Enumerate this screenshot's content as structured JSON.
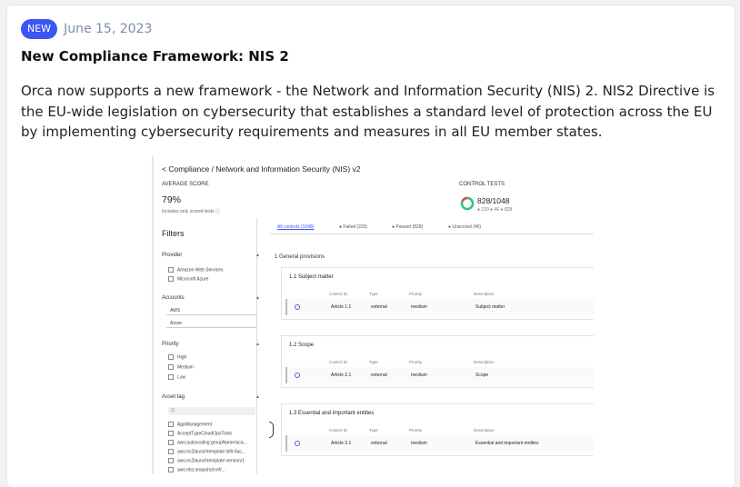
{
  "post": {
    "badge": "NEW",
    "date": "June 15, 2023",
    "title": "New Compliance Framework: NIS 2",
    "body": "Orca now supports a new framework - the Network and Information Security (NIS) 2.  NIS2 Directive is the EU-wide legislation on cybersecurity that establishes a standard level of protection across the EU by implementing cybersecurity requirements and measures in all EU member states."
  },
  "screenshot": {
    "breadcrumb": "< Compliance / Network and Information Security (NIS) v2",
    "avg_label": "AVERAGE SCORE",
    "avg_value": "79%",
    "avg_note": "Includes only scored tests ⓘ",
    "ct_label": "CONTROL TESTS",
    "ct_value": "828/1048",
    "ct_sub": "● 220  ● 46  ● 828",
    "filters_title": "Filters",
    "provider_label": "Provider",
    "provider_options": [
      "Amazon Web Services",
      "Microsoft Azure"
    ],
    "accounts_label": "Accounts",
    "accounts_options": [
      "AWS",
      "Azure"
    ],
    "priority_label": "Priority",
    "priority_options": [
      "High",
      "Medium",
      "Low"
    ],
    "asset_tag_label": "Asset tag",
    "asset_tag_search": "Q",
    "asset_tag_options": [
      "AppManagement",
      "AcceptTypeCloudOpsTools",
      "aws:autoscaling:groupName/aca...",
      "aws:ec2launchtemplate:id/ll-0ac...",
      "aws:ec2launchtemplate:version/1",
      "aws:ebs:snapshot:ref/..."
    ],
    "tabs": [
      "All controls (1048)",
      "● Failed (220)",
      "● Passed (828)",
      "● Unscored (46)"
    ],
    "section": "1 General provisions",
    "col_headers": [
      "Control ID",
      "Type",
      "Priority",
      "Description"
    ],
    "groups": [
      {
        "title": "1.1 Subject matter",
        "control": "Article 1.1",
        "type": "external",
        "priority": "medium",
        "description": "Subject matter"
      },
      {
        "title": "1.2 Scope",
        "control": "Article 2.1",
        "type": "external",
        "priority": "medium",
        "description": "Scope"
      },
      {
        "title": "1.3 Essential and important entities",
        "control": "Article 3.1",
        "type": "external",
        "priority": "medium",
        "description": "Essential and important entities"
      }
    ]
  },
  "colors": {
    "accent": "#3b56f5",
    "date": "#7c8bb0"
  }
}
